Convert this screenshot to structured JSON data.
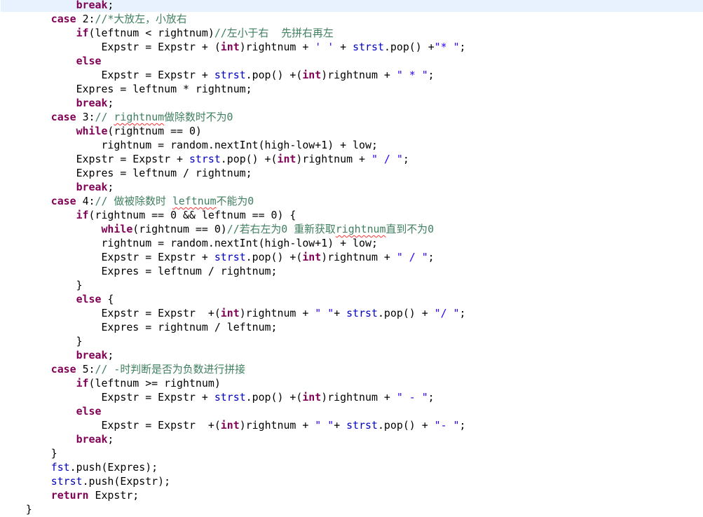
{
  "colors": {
    "keyword": "#7f0055",
    "comment": "#3f7f5f",
    "string": "#2a00ff",
    "field": "#0000c0",
    "current_line": "#e8f2fe"
  },
  "lines": [
    {
      "indent": 12,
      "current": true,
      "tokens": [
        [
          "k",
          "break"
        ],
        [
          "p",
          ";"
        ]
      ]
    },
    {
      "indent": 8,
      "tokens": [
        [
          "k",
          "case"
        ],
        [
          "p",
          " 2:"
        ],
        [
          "c",
          "//*大放左，小放右"
        ]
      ]
    },
    {
      "indent": 12,
      "tokens": [
        [
          "k",
          "if"
        ],
        [
          "p",
          "(leftnum < rightnum)"
        ],
        [
          "c",
          "//左小于右  先拼右再左"
        ]
      ]
    },
    {
      "indent": 16,
      "tokens": [
        [
          "p",
          "Expstr = Expstr + ("
        ],
        [
          "k",
          "int"
        ],
        [
          "p",
          ")rightnum + "
        ],
        [
          "s",
          "' '"
        ],
        [
          "p",
          " + "
        ],
        [
          "f",
          "strst"
        ],
        [
          "p",
          ".pop() +"
        ],
        [
          "s",
          "\"* \""
        ],
        [
          "p",
          ";"
        ]
      ]
    },
    {
      "indent": 12,
      "tokens": [
        [
          "k",
          "else"
        ]
      ]
    },
    {
      "indent": 16,
      "tokens": [
        [
          "p",
          "Expstr = Expstr + "
        ],
        [
          "f",
          "strst"
        ],
        [
          "p",
          ".pop() +("
        ],
        [
          "k",
          "int"
        ],
        [
          "p",
          ")rightnum + "
        ],
        [
          "s",
          "\" * \""
        ],
        [
          "p",
          ";"
        ]
      ]
    },
    {
      "indent": 12,
      "tokens": [
        [
          "p",
          "Expres = leftnum * rightnum;"
        ]
      ]
    },
    {
      "indent": 12,
      "tokens": [
        [
          "k",
          "break"
        ],
        [
          "p",
          ";"
        ]
      ]
    },
    {
      "indent": 8,
      "tokens": [
        [
          "k",
          "case"
        ],
        [
          "p",
          " 3:"
        ],
        [
          "c",
          "// "
        ],
        [
          "cu",
          "rightnum"
        ],
        [
          "c",
          "做除数时不为0"
        ]
      ]
    },
    {
      "indent": 12,
      "tokens": [
        [
          "k",
          "while"
        ],
        [
          "p",
          "(rightnum == 0)"
        ]
      ]
    },
    {
      "indent": 16,
      "tokens": [
        [
          "p",
          "rightnum = random.nextInt(high-low+1) + low;"
        ]
      ]
    },
    {
      "indent": 12,
      "tokens": [
        [
          "p",
          "Expstr = Expstr + "
        ],
        [
          "f",
          "strst"
        ],
        [
          "p",
          ".pop() +("
        ],
        [
          "k",
          "int"
        ],
        [
          "p",
          ")rightnum + "
        ],
        [
          "s",
          "\" / \""
        ],
        [
          "p",
          ";"
        ]
      ]
    },
    {
      "indent": 12,
      "tokens": [
        [
          "p",
          "Expres = leftnum / rightnum;"
        ]
      ]
    },
    {
      "indent": 12,
      "tokens": [
        [
          "k",
          "break"
        ],
        [
          "p",
          ";"
        ]
      ]
    },
    {
      "indent": 8,
      "tokens": [
        [
          "k",
          "case"
        ],
        [
          "p",
          " 4:"
        ],
        [
          "c",
          "// 做被除数时 "
        ],
        [
          "cu",
          "leftnum"
        ],
        [
          "c",
          "不能为0"
        ]
      ]
    },
    {
      "indent": 12,
      "tokens": [
        [
          "k",
          "if"
        ],
        [
          "p",
          "(rightnum == 0 && leftnum == 0) {"
        ]
      ]
    },
    {
      "indent": 16,
      "tokens": [
        [
          "k",
          "while"
        ],
        [
          "p",
          "(rightnum == 0)"
        ],
        [
          "c",
          "//若右左为0 重新获取"
        ],
        [
          "cu",
          "rightnum"
        ],
        [
          "c",
          "直到不为0"
        ]
      ]
    },
    {
      "indent": 16,
      "tokens": [
        [
          "p",
          "rightnum = random.nextInt(high-low+1) + low;"
        ]
      ]
    },
    {
      "indent": 16,
      "tokens": [
        [
          "p",
          "Expstr = Expstr + "
        ],
        [
          "f",
          "strst"
        ],
        [
          "p",
          ".pop() +("
        ],
        [
          "k",
          "int"
        ],
        [
          "p",
          ")rightnum + "
        ],
        [
          "s",
          "\" / \""
        ],
        [
          "p",
          ";"
        ]
      ]
    },
    {
      "indent": 16,
      "tokens": [
        [
          "p",
          "Expres = leftnum / rightnum;"
        ]
      ]
    },
    {
      "indent": 12,
      "tokens": [
        [
          "p",
          "}"
        ]
      ]
    },
    {
      "indent": 12,
      "tokens": [
        [
          "k",
          "else"
        ],
        [
          "p",
          " {"
        ]
      ]
    },
    {
      "indent": 16,
      "tokens": [
        [
          "p",
          "Expstr = Expstr  +("
        ],
        [
          "k",
          "int"
        ],
        [
          "p",
          ")rightnum + "
        ],
        [
          "s",
          "\" \""
        ],
        [
          "p",
          "+ "
        ],
        [
          "f",
          "strst"
        ],
        [
          "p",
          ".pop() + "
        ],
        [
          "s",
          "\"/ \""
        ],
        [
          "p",
          ";"
        ]
      ]
    },
    {
      "indent": 16,
      "tokens": [
        [
          "p",
          "Expres = rightnum / leftnum;"
        ]
      ]
    },
    {
      "indent": 12,
      "tokens": [
        [
          "p",
          "}"
        ]
      ]
    },
    {
      "indent": 12,
      "tokens": [
        [
          "k",
          "break"
        ],
        [
          "p",
          ";"
        ]
      ]
    },
    {
      "indent": 8,
      "tokens": [
        [
          "k",
          "case"
        ],
        [
          "p",
          " 5:"
        ],
        [
          "c",
          "// -时判断是否为负数进行拼接"
        ]
      ]
    },
    {
      "indent": 12,
      "tokens": [
        [
          "k",
          "if"
        ],
        [
          "p",
          "(leftnum >= rightnum)"
        ]
      ]
    },
    {
      "indent": 16,
      "tokens": [
        [
          "p",
          "Expstr = Expstr + "
        ],
        [
          "f",
          "strst"
        ],
        [
          "p",
          ".pop() +("
        ],
        [
          "k",
          "int"
        ],
        [
          "p",
          ")rightnum + "
        ],
        [
          "s",
          "\" - \""
        ],
        [
          "p",
          ";"
        ]
      ]
    },
    {
      "indent": 12,
      "tokens": [
        [
          "k",
          "else"
        ]
      ]
    },
    {
      "indent": 16,
      "tokens": [
        [
          "p",
          "Expstr = Expstr  +("
        ],
        [
          "k",
          "int"
        ],
        [
          "p",
          ")rightnum + "
        ],
        [
          "s",
          "\" \""
        ],
        [
          "p",
          "+ "
        ],
        [
          "f",
          "strst"
        ],
        [
          "p",
          ".pop() + "
        ],
        [
          "s",
          "\"- \""
        ],
        [
          "p",
          ";"
        ]
      ]
    },
    {
      "indent": 12,
      "tokens": [
        [
          "k",
          "break"
        ],
        [
          "p",
          ";"
        ]
      ]
    },
    {
      "indent": 8,
      "tokens": [
        [
          "p",
          "}"
        ]
      ]
    },
    {
      "indent": 8,
      "tokens": [
        [
          "f",
          "fst"
        ],
        [
          "p",
          ".push(Expres);"
        ]
      ]
    },
    {
      "indent": 8,
      "tokens": [
        [
          "f",
          "strst"
        ],
        [
          "p",
          ".push(Expstr);"
        ]
      ]
    },
    {
      "indent": 8,
      "tokens": [
        [
          "k",
          "return"
        ],
        [
          "p",
          " Expstr;"
        ]
      ]
    },
    {
      "indent": 4,
      "tokens": [
        [
          "p",
          "}"
        ]
      ]
    }
  ]
}
